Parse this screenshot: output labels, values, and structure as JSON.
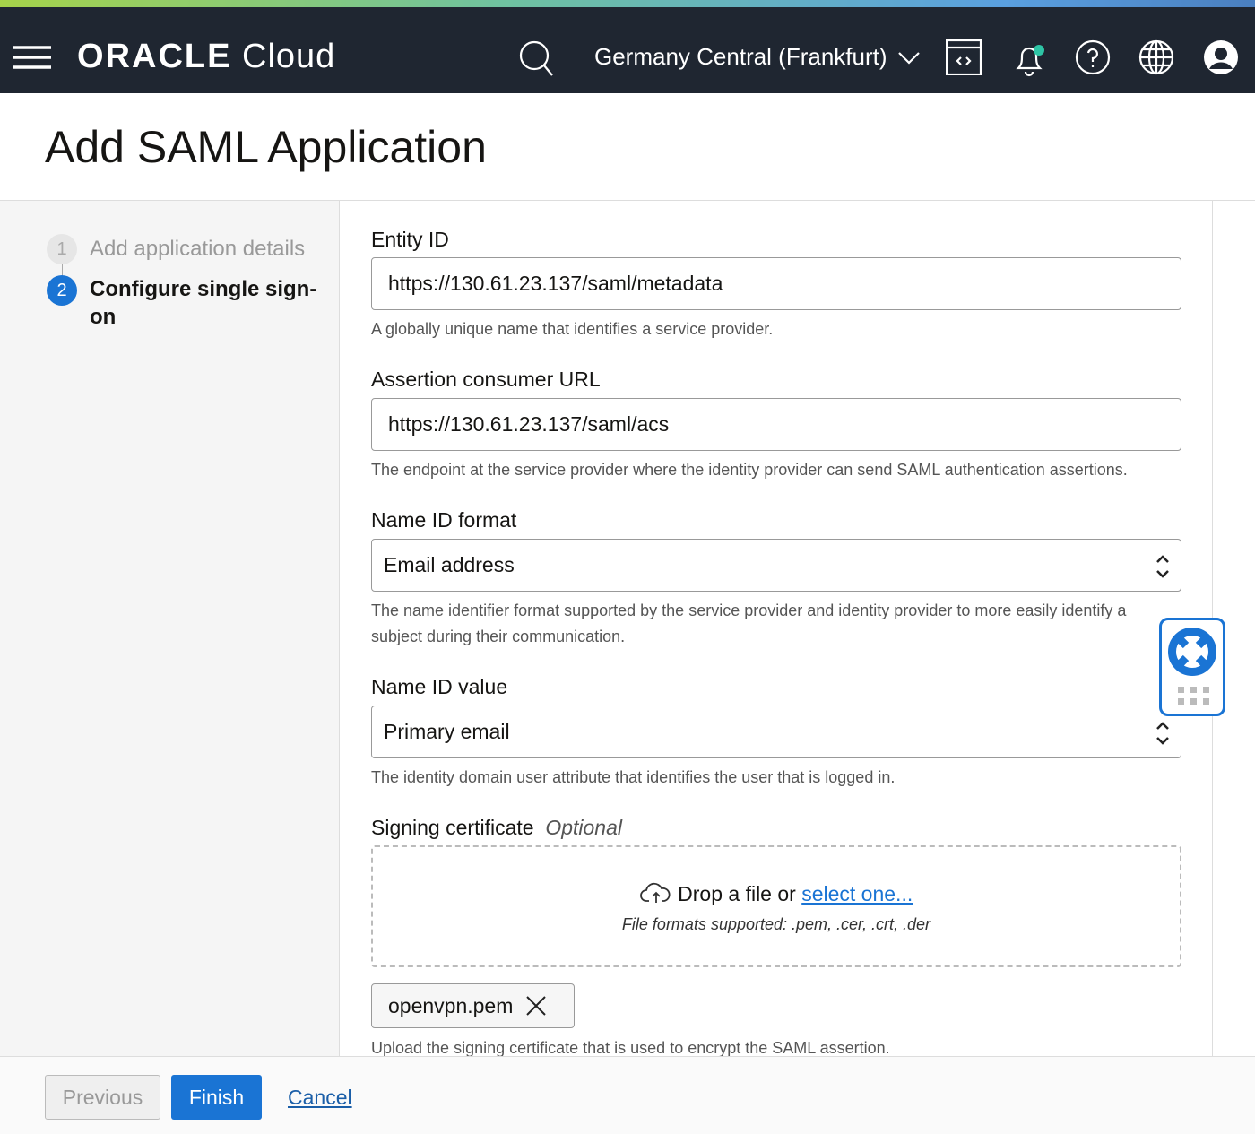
{
  "nav": {
    "logo_brand": "ORACLE",
    "logo_product": "Cloud",
    "region": "Germany Central (Frankfurt)",
    "icons": [
      "menu-icon",
      "search-icon",
      "chevron-down-icon",
      "code-editor-icon",
      "bell-icon",
      "help-icon",
      "globe-icon",
      "user-avatar-icon"
    ],
    "notification_color": "#2ec4a5"
  },
  "header": {
    "title": "Add SAML Application"
  },
  "steps": [
    {
      "num": "1",
      "label": "Add application details"
    },
    {
      "num": "2",
      "label": "Configure single sign-on"
    }
  ],
  "form": {
    "entity_id": {
      "label": "Entity ID",
      "value": "https://130.61.23.137/saml/metadata",
      "help": "A globally unique name that identifies a service provider."
    },
    "acs_url": {
      "label": "Assertion consumer URL",
      "value": "https://130.61.23.137/saml/acs",
      "help": "The endpoint at the service provider where the identity provider can send SAML authentication assertions."
    },
    "name_id_format": {
      "label": "Name ID format",
      "value": "Email address",
      "help": "The name identifier format supported by the service provider and identity provider to more easily identify a subject during their communication."
    },
    "name_id_value": {
      "label": "Name ID value",
      "value": "Primary email",
      "help": "The identity domain user attribute that identifies the user that is logged in."
    },
    "signing_cert": {
      "label": "Signing certificate",
      "optional": "Optional",
      "drop_text": "Drop a file or",
      "select_link": "select one...",
      "formats": "File formats supported: .pem, .cer, .crt, .der",
      "file": "openvpn.pem",
      "help": "Upload the signing certificate that is used to encrypt the SAML assertion."
    }
  },
  "footer": {
    "previous": "Previous",
    "finish": "Finish",
    "cancel": "Cancel"
  },
  "colors": {
    "accent": "#1a74d4",
    "nav_bg": "#1f2631"
  }
}
